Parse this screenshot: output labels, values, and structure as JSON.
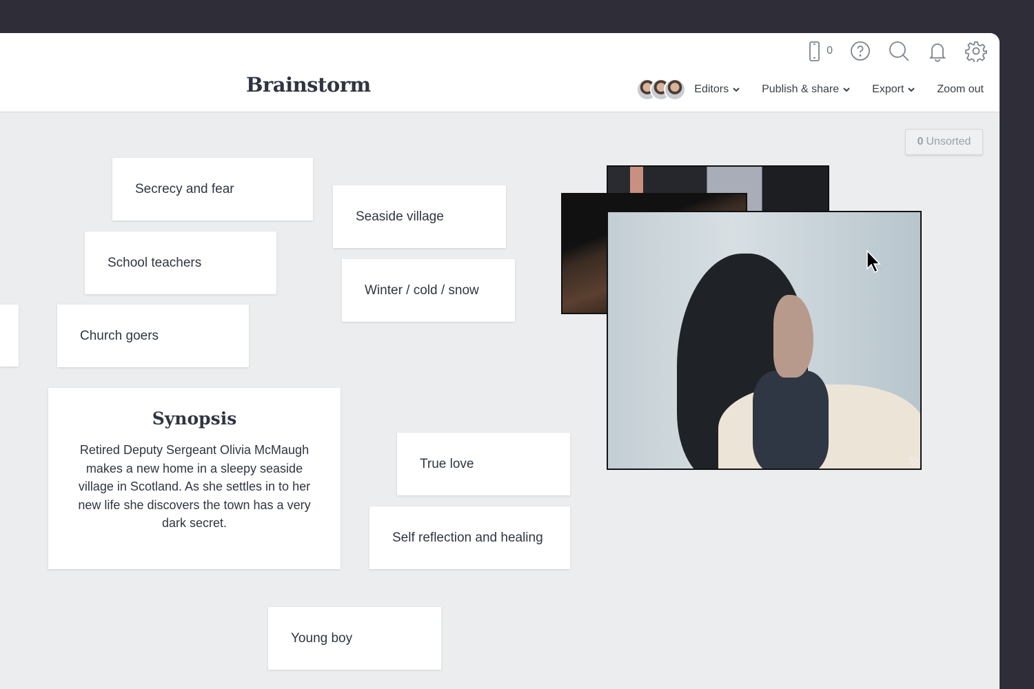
{
  "header": {
    "title": "Brainstorm",
    "device_count": "0",
    "icons": [
      "phone-icon",
      "help-icon",
      "search-icon",
      "bell-icon",
      "gear-icon"
    ],
    "nav": {
      "editors": "Editors",
      "publish": "Publish & share",
      "export": "Export",
      "zoom_out": "Zoom out"
    }
  },
  "canvas": {
    "unsorted_count": "0",
    "unsorted_label": "Unsorted",
    "cards": [
      "Secrecy and fear",
      "Seaside village",
      "School teachers",
      "Winter / cold / snow",
      "Church goers",
      "True love",
      "Self reflection and healing",
      "Young boy"
    ],
    "synopsis": {
      "title": "Synopsis",
      "body": "Retired Deputy Sergeant Olivia McMaugh makes a new home in a sleepy seaside village in Scotland. As she settles in to her new life she discovers the town has a very dark secret."
    }
  },
  "colors": {
    "frame": "#2e2d38",
    "canvas": "#ecedef",
    "text": "#2f3540"
  }
}
